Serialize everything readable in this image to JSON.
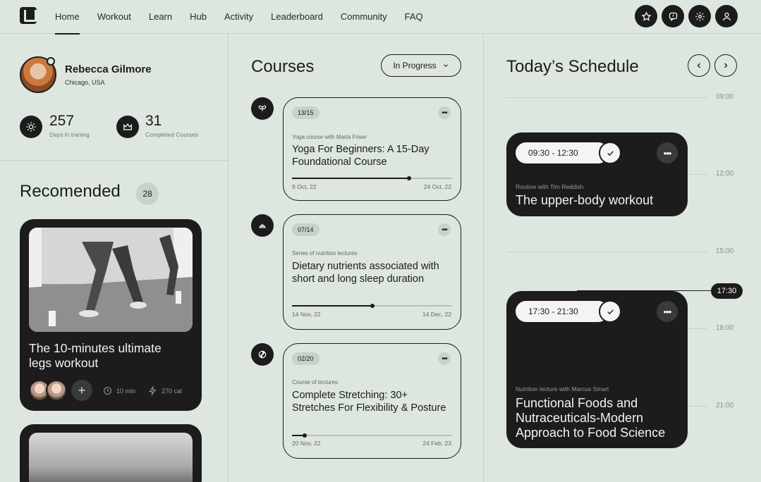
{
  "nav": {
    "items": [
      {
        "label": "Home",
        "active": true
      },
      {
        "label": "Workout"
      },
      {
        "label": "Learn"
      },
      {
        "label": "Hub"
      },
      {
        "label": "Activity"
      },
      {
        "label": "Leaderboard"
      },
      {
        "label": "Community"
      },
      {
        "label": "FAQ"
      }
    ],
    "icons": [
      "star-icon",
      "chat-icon",
      "gear-icon",
      "user-icon"
    ]
  },
  "profile": {
    "name": "Rebecca Gilmore",
    "location": "Chicago, USA",
    "stats": [
      {
        "value": "257",
        "label": "Days in traning",
        "icon": "sun-icon"
      },
      {
        "value": "31",
        "label": "Completed Courses",
        "icon": "crown-icon"
      }
    ]
  },
  "recommended": {
    "title": "Recomended",
    "count": "28",
    "card": {
      "title": "The 10-minutes ultimate legs workout",
      "duration": "10 min",
      "calories": "270 cal",
      "add_label": "+"
    }
  },
  "courses": {
    "title": "Courses",
    "filter": "In Progress",
    "items": [
      {
        "badge": "13/15",
        "subtitle": "Yoga course with Marta Friser",
        "name": "Yoga For Beginners: A 15-Day Foundational Course",
        "start": "9 Oct, 22",
        "end": "24 Oct, 22",
        "progress": 0.73,
        "icon": "butterfly-icon"
      },
      {
        "badge": "07/14",
        "subtitle": "Series of nutrition lectures",
        "name": "Dietary nutrients associated with short and long sleep duration",
        "start": "14 Nov, 22",
        "end": "14 Dec, 22",
        "progress": 0.5,
        "icon": "food-dome-icon"
      },
      {
        "badge": "02/20",
        "subtitle": "Course of lectures",
        "name": "Complete Stretching: 30+ Stretches For Flexibility & Posture",
        "start": "20 Nov, 22",
        "end": "24 Feb, 23",
        "progress": 0.08,
        "icon": "yinyang-icon"
      }
    ]
  },
  "schedule": {
    "title": "Today’s Schedule",
    "hours": [
      "09:00",
      "12:00",
      "15:00",
      "18:00",
      "21:00"
    ],
    "now": "17:30",
    "events": [
      {
        "time": "09:30 - 12:30",
        "subtitle": "Routine with Tim Reddish",
        "name": "The upper-body workout"
      },
      {
        "time": "17:30 - 21:30",
        "subtitle": "Nutrition lecture with Marcus Smart",
        "name": "Functional Foods and Nutraceuticals-Modern Approach to Food Science"
      }
    ]
  },
  "colors": {
    "background": "#dde6df",
    "dark": "#1c1c1c",
    "chip": "#c9d1cb"
  }
}
